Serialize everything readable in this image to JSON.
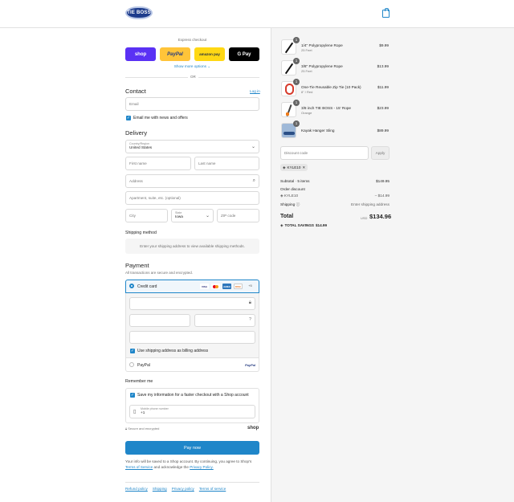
{
  "header": {
    "logo_text": "TIE BOSS",
    "cart_icon": "shopping-bag-icon"
  },
  "express": {
    "label": "Express checkout",
    "buttons": [
      "shop",
      "PayPal",
      "amazon pay",
      "G Pay"
    ],
    "more": "Show more options",
    "or": "OR"
  },
  "contact": {
    "title": "Contact",
    "login": "Log in",
    "email_placeholder": "Email",
    "news_label": "Email me with news and offers"
  },
  "delivery": {
    "title": "Delivery",
    "country_label": "Country/Region",
    "country_value": "United States",
    "first": "First name",
    "last": "Last name",
    "address": "Address",
    "apt": "Apartment, suite, etc. (optional)",
    "city": "City",
    "state_label": "State",
    "state_value": "Iowa",
    "zip": "ZIP code"
  },
  "shipping": {
    "title": "Shipping method",
    "message": "Enter your shipping address to view available shipping methods."
  },
  "payment": {
    "title": "Payment",
    "subtitle": "All transactions are secure and encrypted.",
    "credit_card": "Credit card",
    "cards": [
      "VISA",
      "MC",
      "AMEX",
      "DISC"
    ],
    "more_cards": "+5",
    "billing_label": "Use shipping address as billing address",
    "paypal": "PayPal",
    "paypal_logo": "PayPal"
  },
  "remember": {
    "title": "Remember me",
    "save_label": "Save my information for a faster checkout with a Shop account",
    "phone_label": "Mobile phone number",
    "phone_value": "+1",
    "secure": "Secure and encrypted",
    "shop_logo": "shop"
  },
  "paynow": "Pay now",
  "legal": {
    "text": "Your info will be saved to a Shop account. By continuing, you agree to Shop's",
    "terms": "Terms of Service",
    "and": "and acknowledge the",
    "privacy": "Privacy Policy."
  },
  "footer_links": [
    "Refund policy",
    "Shipping",
    "Privacy policy",
    "Terms of service"
  ],
  "summary": {
    "items": [
      {
        "title": "1/4\" Polypropylene Rope",
        "sub": "25 Feet",
        "price": "$9.99",
        "qty": "1"
      },
      {
        "title": "3/8\" Polypropylene Rope",
        "sub": "25 Feet",
        "price": "$13.99",
        "qty": "1"
      },
      {
        "title": "One-Tie Reusable Zip Tie (10 Pack)",
        "sub": "8\" / Red",
        "price": "$11.99",
        "qty": "1"
      },
      {
        "title": "3/8 inch TIE BOSS - 15' Rope",
        "sub": "Orange",
        "price": "$23.99",
        "qty": "1"
      },
      {
        "title": "Kayak Hanger Sling",
        "sub": "",
        "price": "$89.99",
        "qty": "1"
      }
    ],
    "discount_placeholder": "Discount code",
    "apply": "Apply",
    "tag": "KYLE10",
    "subtotal_label": "Subtotal · 5 items",
    "subtotal": "$149.95",
    "order_discount": "Order discount",
    "discount_code": "KYLE10",
    "discount_value": "– $14.99",
    "shipping_label": "Shipping",
    "shipping_value": "Enter shipping address",
    "total_label": "Total",
    "currency": "USD",
    "total": "$134.96",
    "savings_label": "TOTAL SAVINGS",
    "savings": "$14.99"
  }
}
